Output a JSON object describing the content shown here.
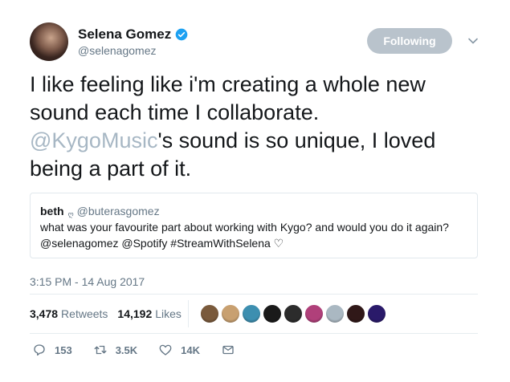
{
  "user": {
    "display_name": "Selena Gomez",
    "handle": "@selenagomez",
    "verified": true
  },
  "follow_button": {
    "label": "Following"
  },
  "tweet": {
    "line1": "I like feeling like i'm creating a whole new",
    "line2": "sound each time I collaborate.",
    "mention": "@KygoMusic",
    "line3_rest": "'s sound is so unique, I loved",
    "line4": "being a part of it."
  },
  "quote": {
    "name": "beth",
    "glyph": "ღ",
    "handle": "@buterasgomez",
    "line1": "what was your favourite part about working with Kygo? and would you do it again?",
    "line2": "@selenagomez @Spotify #StreamWithSelena ♡"
  },
  "timestamp": "3:15 PM - 14 Aug 2017",
  "stats": {
    "retweets_count": "3,478",
    "retweets_label": "Retweets",
    "likes_count": "14,192",
    "likes_label": "Likes"
  },
  "liker_avatar_colors": [
    "#7a5a3c",
    "#c8a070",
    "#3d8fb0",
    "#1a1a1a",
    "#2c2c2c",
    "#b0407a",
    "#aab8c2",
    "#301818",
    "#2a1a6a"
  ],
  "actions": {
    "replies": "153",
    "retweets": "3.5K",
    "likes": "14K"
  },
  "colors": {
    "link": "#a7b7c4",
    "secondary": "#657786",
    "verified": "#1da1f2",
    "follow_bg": "#b9c3cc"
  }
}
